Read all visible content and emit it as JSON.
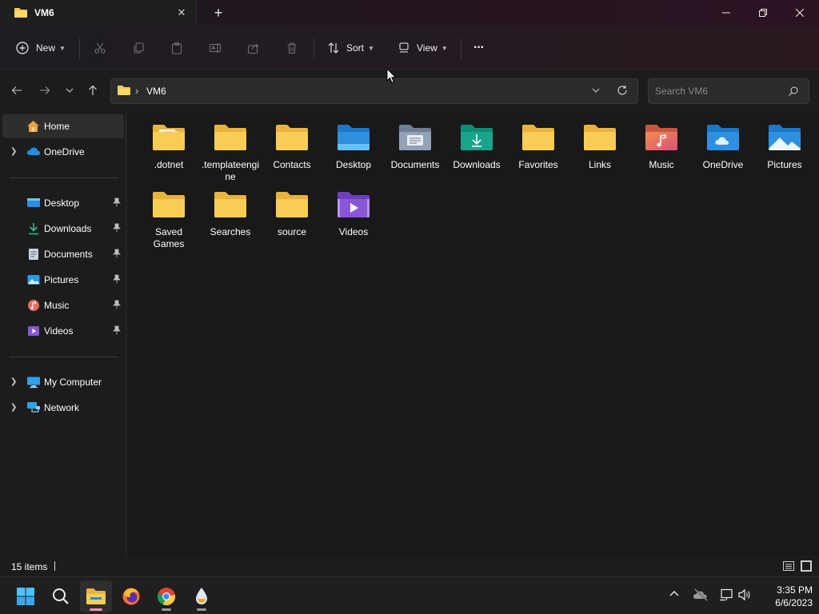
{
  "window": {
    "tab_title": "VM6",
    "tab_close": "✕",
    "new_tab": "+"
  },
  "toolbar": {
    "new_label": "New",
    "sort_label": "Sort",
    "view_label": "View",
    "more_label": "···"
  },
  "address": {
    "path": "VM6",
    "separator": "›",
    "search_placeholder": "Search VM6"
  },
  "sidebar": {
    "home": "Home",
    "onedrive": "OneDrive",
    "quick_access": [
      {
        "label": "Desktop",
        "icon": "desktop-icon"
      },
      {
        "label": "Downloads",
        "icon": "downloads-icon"
      },
      {
        "label": "Documents",
        "icon": "documents-icon"
      },
      {
        "label": "Pictures",
        "icon": "pictures-icon"
      },
      {
        "label": "Music",
        "icon": "music-icon"
      },
      {
        "label": "Videos",
        "icon": "videos-icon"
      }
    ],
    "my_computer": "My Computer",
    "network": "Network"
  },
  "folders": [
    {
      "name": ".dotnet",
      "icon": "folder-icon"
    },
    {
      "name": ".templateengine",
      "icon": "folder-icon"
    },
    {
      "name": "Contacts",
      "icon": "folder-icon"
    },
    {
      "name": "Desktop",
      "icon": "desktop-folder-icon"
    },
    {
      "name": "Documents",
      "icon": "documents-folder-icon"
    },
    {
      "name": "Downloads",
      "icon": "downloads-folder-icon"
    },
    {
      "name": "Favorites",
      "icon": "folder-icon"
    },
    {
      "name": "Links",
      "icon": "folder-icon"
    },
    {
      "name": "Music",
      "icon": "music-folder-icon"
    },
    {
      "name": "OneDrive",
      "icon": "onedrive-folder-icon"
    },
    {
      "name": "Pictures",
      "icon": "pictures-folder-icon"
    },
    {
      "name": "Saved Games",
      "icon": "folder-icon"
    },
    {
      "name": "Searches",
      "icon": "folder-icon"
    },
    {
      "name": "source",
      "icon": "folder-icon"
    },
    {
      "name": "Videos",
      "icon": "videos-folder-icon"
    }
  ],
  "status": {
    "item_count": "15 items"
  },
  "taskbar": {
    "time": "3:35 PM",
    "date": "6/6/2023"
  },
  "colors": {
    "folder_yellow": "#f8cd55",
    "folder_blue": "#2e8fe0",
    "folder_teal": "#1aa38c",
    "folder_purple": "#8a56d8",
    "folder_music": "#e9735e",
    "accent": "#4cc2ff"
  }
}
